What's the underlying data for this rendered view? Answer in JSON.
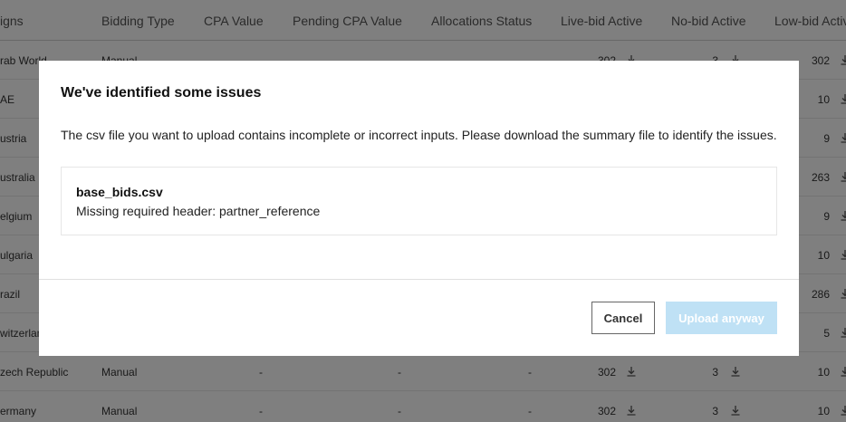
{
  "table": {
    "columns": [
      {
        "label": "igns"
      },
      {
        "label": "Bidding Type"
      },
      {
        "label": "CPA Value"
      },
      {
        "label": "Pending CPA Value"
      },
      {
        "label": "Allocations Status"
      },
      {
        "label": "Live-bid Active"
      },
      {
        "label": "No-bid Active"
      },
      {
        "label": "Low-bid Active"
      }
    ],
    "rows": [
      {
        "name": "rab World",
        "bidding": "Manual",
        "cpa": "-",
        "pending": "-",
        "alloc": "-",
        "live": "302",
        "nobid": "3",
        "lowbid": "302"
      },
      {
        "name": "AE",
        "bidding": "",
        "cpa": "",
        "pending": "",
        "alloc": "",
        "live": "",
        "nobid": "",
        "lowbid": "10"
      },
      {
        "name": "ustria",
        "bidding": "",
        "cpa": "",
        "pending": "",
        "alloc": "",
        "live": "",
        "nobid": "",
        "lowbid": "9"
      },
      {
        "name": "ustralia",
        "bidding": "",
        "cpa": "",
        "pending": "",
        "alloc": "",
        "live": "",
        "nobid": "",
        "lowbid": "263"
      },
      {
        "name": "elgium",
        "bidding": "",
        "cpa": "",
        "pending": "",
        "alloc": "",
        "live": "",
        "nobid": "",
        "lowbid": "9"
      },
      {
        "name": "ulgaria",
        "bidding": "",
        "cpa": "",
        "pending": "",
        "alloc": "",
        "live": "",
        "nobid": "",
        "lowbid": "10"
      },
      {
        "name": "razil",
        "bidding": "",
        "cpa": "",
        "pending": "",
        "alloc": "",
        "live": "",
        "nobid": "",
        "lowbid": "286"
      },
      {
        "name": "witzerlan",
        "bidding": "",
        "cpa": "",
        "pending": "",
        "alloc": "",
        "live": "",
        "nobid": "",
        "lowbid": "5"
      },
      {
        "name": "zech Republic",
        "bidding": "Manual",
        "cpa": "-",
        "pending": "-",
        "alloc": "-",
        "live": "302",
        "nobid": "3",
        "lowbid": "10"
      },
      {
        "name": "ermany",
        "bidding": "Manual",
        "cpa": "-",
        "pending": "-",
        "alloc": "-",
        "live": "302",
        "nobid": "3",
        "lowbid": "10"
      }
    ]
  },
  "modal": {
    "title": "We've identified some issues",
    "message": "The csv file you want to upload contains incomplete or incorrect inputs. Please download the summary file to identify the issues.",
    "issue": {
      "file": "base_bids.csv",
      "detail": "Missing required header: partner_reference"
    },
    "cancel_label": "Cancel",
    "upload_label": "Upload anyway"
  },
  "colors": {
    "overlay": "#000000",
    "upload_button": "#bfe1f5"
  },
  "icons": {
    "download": "download-icon"
  }
}
